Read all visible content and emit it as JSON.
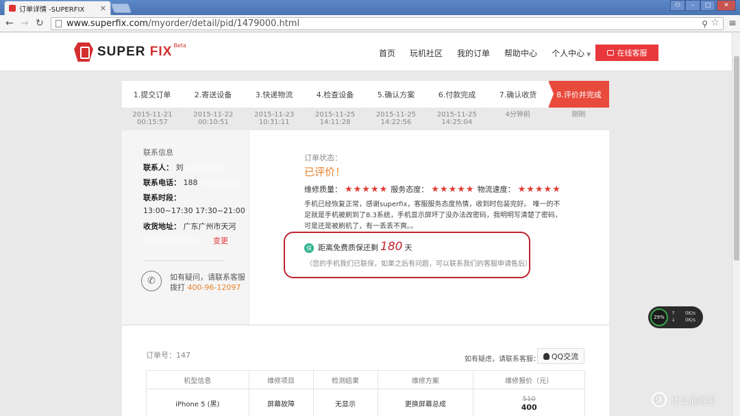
{
  "browser": {
    "tab_title": "订单详情 -SUPERFIX",
    "url_host": "www.superfix.com",
    "url_path": "/myorder/detail/pid/1479000.html"
  },
  "header": {
    "logo_text_a": "SUPER",
    "logo_text_b": "FIX",
    "logo_beta": "Beta",
    "nav": [
      "首页",
      "玩机社区",
      "我的订单",
      "帮助中心",
      "个人中心"
    ],
    "online_service": "在线客服"
  },
  "steps": [
    {
      "label": "1.提交订单",
      "date": "2015-11-21",
      "time": "00:15:57"
    },
    {
      "label": "2.寄送设备",
      "date": "2015-11-22",
      "time": "00:10:51"
    },
    {
      "label": "3.快递物流",
      "date": "2015-11-23",
      "time": "10:31:11"
    },
    {
      "label": "4.检查设备",
      "date": "2015-11-25",
      "time": "14:11:28"
    },
    {
      "label": "5.确认方案",
      "date": "2015-11-25",
      "time": "14:22:56"
    },
    {
      "label": "6.付款完成",
      "date": "2015-11-25",
      "time": "14:25:04"
    },
    {
      "label": "7.确认收货",
      "date": "4分钟前",
      "time": ""
    },
    {
      "label": "8.评价并完成",
      "date": "刚刚",
      "time": ""
    }
  ],
  "contact": {
    "title": "联系信息",
    "person_label": "联系人：",
    "person_value": "刘",
    "phone_label": "联系电话：",
    "phone_value": "188",
    "time_label": "联系时段：",
    "time_value": "13:00~17:30 17:30~21:00",
    "address_label": "收货地址：",
    "address_value": "广东广州市天河",
    "change": "变更",
    "help_line1": "如有疑问，请联系客服",
    "help_line2": "拨打",
    "help_phone": "400-96-12097"
  },
  "order_status": {
    "label": "订单状态：",
    "value": "已评价！",
    "ratings": [
      {
        "label": "维修质量：",
        "stars": 5
      },
      {
        "label": "服务态度：",
        "stars": 5
      },
      {
        "label": "物流速度：",
        "stars": 5
      }
    ],
    "stars_text": "★★★★★",
    "review": "手机已经恢复正常，感谢superfix，客服服务态度热情，收到时包装完好。 唯一的不足就是手机被刷到了8.3系统，手机显示屏坏了没办法改密码，我明明写清楚了密码，可是还是被刷机了，有一丢丢不爽。。",
    "warranty_icon": "保",
    "warranty_prefix": "距离免费质保还剩",
    "warranty_days": "180",
    "warranty_suffix": "天",
    "warranty_note": "（您的手机我们已联保，如果之后有问题，可以联系我们的客服申请售后）"
  },
  "order": {
    "order_no": "订单号：147",
    "help": "如有疑虑，请联系客服：",
    "qq": "QQ交流",
    "columns": [
      "机型信息",
      "维修项目",
      "检测结果",
      "维修方案",
      "维修报价（元）"
    ],
    "row": {
      "model": "iPhone 5 (黑)",
      "item": "屏幕故障",
      "result": "无显示",
      "plan": "更换屏幕总成",
      "price_old": "510",
      "price_new": "400"
    }
  },
  "net_widget": {
    "pct": "29%",
    "up": "0K/s",
    "down": "0K/s"
  },
  "watermark": {
    "icon": "值",
    "text": "什么值得买"
  }
}
